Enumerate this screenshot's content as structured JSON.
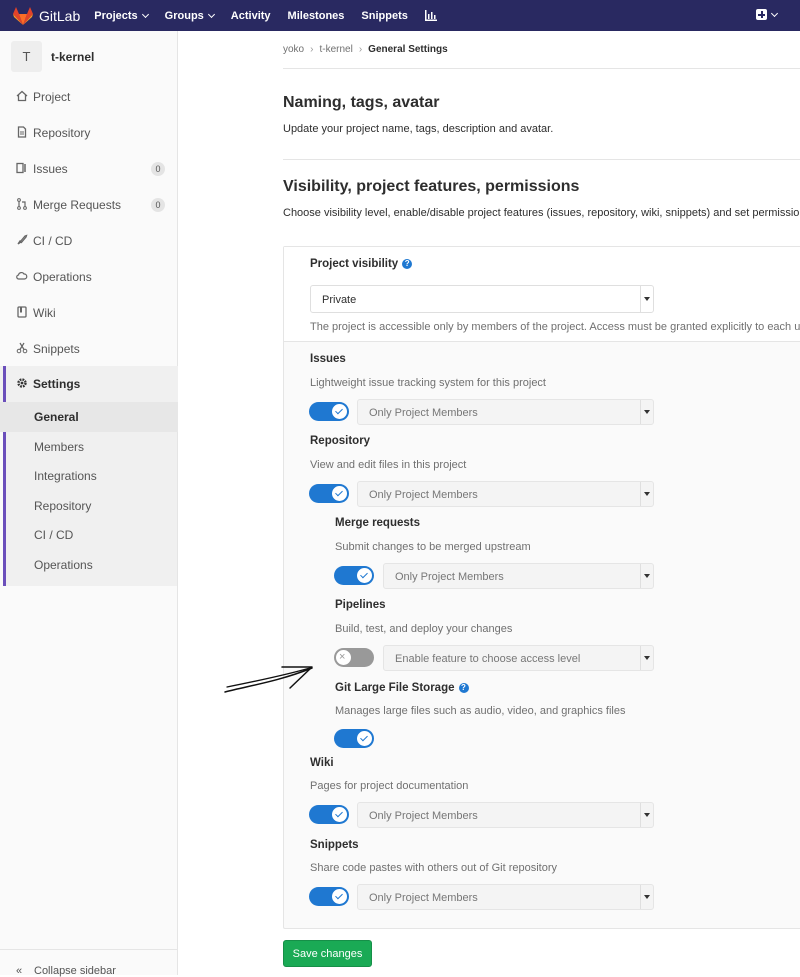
{
  "nav": {
    "brand": "GitLab",
    "items": [
      "Projects",
      "Groups",
      "Activity",
      "Milestones",
      "Snippets"
    ]
  },
  "sidebar": {
    "avatar_letter": "T",
    "project_name": "t-kernel",
    "items": [
      {
        "label": "Project",
        "icon": "home-icon"
      },
      {
        "label": "Repository",
        "icon": "doc-icon"
      },
      {
        "label": "Issues",
        "icon": "issues-icon",
        "count": "0"
      },
      {
        "label": "Merge Requests",
        "icon": "merge-icon",
        "count": "0"
      },
      {
        "label": "CI / CD",
        "icon": "rocket-icon"
      },
      {
        "label": "Operations",
        "icon": "cloud-gear-icon"
      },
      {
        "label": "Wiki",
        "icon": "book-icon"
      },
      {
        "label": "Snippets",
        "icon": "scissors-icon"
      },
      {
        "label": "Settings",
        "icon": "gear-icon"
      }
    ],
    "settings_sub": [
      "General",
      "Members",
      "Integrations",
      "Repository",
      "CI / CD",
      "Operations"
    ],
    "collapse_label": "Collapse sidebar"
  },
  "breadcrumb": [
    "yoko",
    "t-kernel",
    "General Settings"
  ],
  "sections": {
    "naming_title": "Naming, tags, avatar",
    "naming_desc": "Update your project name, tags, description and avatar.",
    "vis_title": "Visibility, project features, permissions",
    "vis_desc": "Choose visibility level, enable/disable project features (issues, repository, wiki, snippets) and set permissions."
  },
  "visibility": {
    "label": "Project visibility",
    "value": "Private",
    "desc": "The project is accessible only by members of the project. Access must be granted explicitly to each user."
  },
  "features": [
    {
      "title": "Issues",
      "desc": "Lightweight issue tracking system for this project",
      "enabled": true,
      "access": "Only Project Members"
    },
    {
      "title": "Repository",
      "desc": "View and edit files in this project",
      "enabled": true,
      "access": "Only Project Members"
    },
    {
      "title": "Merge requests",
      "desc": "Submit changes to be merged upstream",
      "enabled": true,
      "access": "Only Project Members"
    },
    {
      "title": "Pipelines",
      "desc": "Build, test, and deploy your changes",
      "enabled": false,
      "access": "Enable feature to choose access level"
    },
    {
      "title": "Git Large File Storage",
      "desc": "Manages large files such as audio, video, and graphics files",
      "enabled": true
    },
    {
      "title": "Wiki",
      "desc": "Pages for project documentation",
      "enabled": true,
      "access": "Only Project Members"
    },
    {
      "title": "Snippets",
      "desc": "Share code pastes with others out of Git repository",
      "enabled": true,
      "access": "Only Project Members"
    }
  ],
  "save_label": "Save changes",
  "colors": {
    "nav": "#292961",
    "accent": "#1f78d1",
    "settings_bar": "#6b4fbb",
    "save": "#1aaa55"
  }
}
